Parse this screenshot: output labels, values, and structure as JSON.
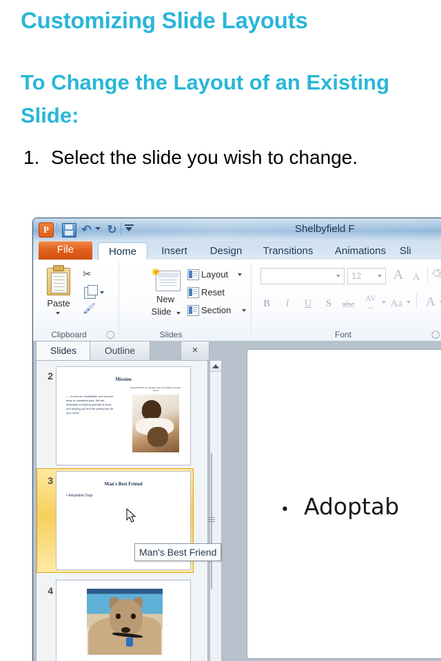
{
  "lesson": {
    "title": "Customizing Slide Layouts",
    "subtitle": "To Change the Layout of an Existing Slide:",
    "steps": [
      {
        "number": "1.",
        "text": "Select the slide you wish to change."
      }
    ],
    "accent_color": "#29b6d8"
  },
  "screenshot": {
    "app": "Microsoft PowerPoint 2010",
    "titlebar": {
      "document_title": "Shelbyfield F",
      "quick_access": [
        {
          "name": "powerpoint-logo",
          "label": "P"
        },
        {
          "name": "save-icon",
          "label": "Save"
        },
        {
          "name": "undo-icon",
          "label": "Undo"
        },
        {
          "name": "redo-icon",
          "label": "Redo"
        },
        {
          "name": "customize-qat-icon",
          "label": "Customize Quick Access Toolbar"
        }
      ]
    },
    "ribbon": {
      "tabs": [
        {
          "label": "File",
          "active": false,
          "style": "file"
        },
        {
          "label": "Home",
          "active": true
        },
        {
          "label": "Insert",
          "active": false
        },
        {
          "label": "Design",
          "active": false
        },
        {
          "label": "Transitions",
          "active": false
        },
        {
          "label": "Animations",
          "active": false
        },
        {
          "label": "Sli",
          "active": false
        }
      ],
      "groups": [
        {
          "name": "clipboard",
          "label": "Clipboard",
          "commands": [
            {
              "label": "Paste",
              "name": "paste-button"
            },
            {
              "label": "Cut",
              "name": "cut-button"
            },
            {
              "label": "Copy",
              "name": "copy-button"
            },
            {
              "label": "Format Painter",
              "name": "format-painter-button"
            }
          ]
        },
        {
          "name": "slides",
          "label": "Slides",
          "commands": [
            {
              "label": "New Slide",
              "name": "new-slide-button"
            },
            {
              "label": "Layout",
              "name": "layout-button"
            },
            {
              "label": "Reset",
              "name": "reset-button"
            },
            {
              "label": "Section",
              "name": "section-button"
            }
          ]
        },
        {
          "name": "font",
          "label": "Font",
          "font_name": "",
          "font_name_placeholder": "",
          "font_size": "12",
          "commands": [
            {
              "label": "A",
              "name": "grow-font-button"
            },
            {
              "label": "A",
              "name": "shrink-font-button"
            },
            {
              "label": "Clear Formatting",
              "name": "clear-formatting-button"
            },
            {
              "label": "B",
              "name": "bold-button"
            },
            {
              "label": "I",
              "name": "italic-button"
            },
            {
              "label": "U",
              "name": "underline-button"
            },
            {
              "label": "S",
              "name": "text-shadow-button"
            },
            {
              "label": "abc",
              "name": "strikethrough-button"
            },
            {
              "label": "AV",
              "name": "character-spacing-button"
            },
            {
              "label": "Aa",
              "name": "change-case-button"
            },
            {
              "label": "A",
              "name": "font-color-button"
            }
          ]
        }
      ]
    },
    "slide_pane": {
      "tabs": [
        {
          "label": "Slides",
          "active": true
        },
        {
          "label": "Outline",
          "active": false
        }
      ],
      "close_label": "×",
      "thumbnails": [
        {
          "number": "2",
          "title": "Mission",
          "body": "…to rescue, rehabilitate, and rehome stray or unwanted pets. We are dedicated to helping animals in need, and helping you find the perfect pet for your home.",
          "caption": "Beautiful Boxer for Families and Your Faithful Loveable Boxer",
          "selected": false,
          "image": "person-holding-kitten"
        },
        {
          "number": "3",
          "title": "Man's Best Friend",
          "body": "Adoptable Dogs",
          "selected": true,
          "image": ""
        },
        {
          "number": "4",
          "title": "",
          "body": "",
          "selected": false,
          "image": "dog-on-beach"
        }
      ],
      "tooltip": "Man's Best Friend"
    },
    "editing_slide": {
      "bullet_text": "Adoptab"
    }
  }
}
